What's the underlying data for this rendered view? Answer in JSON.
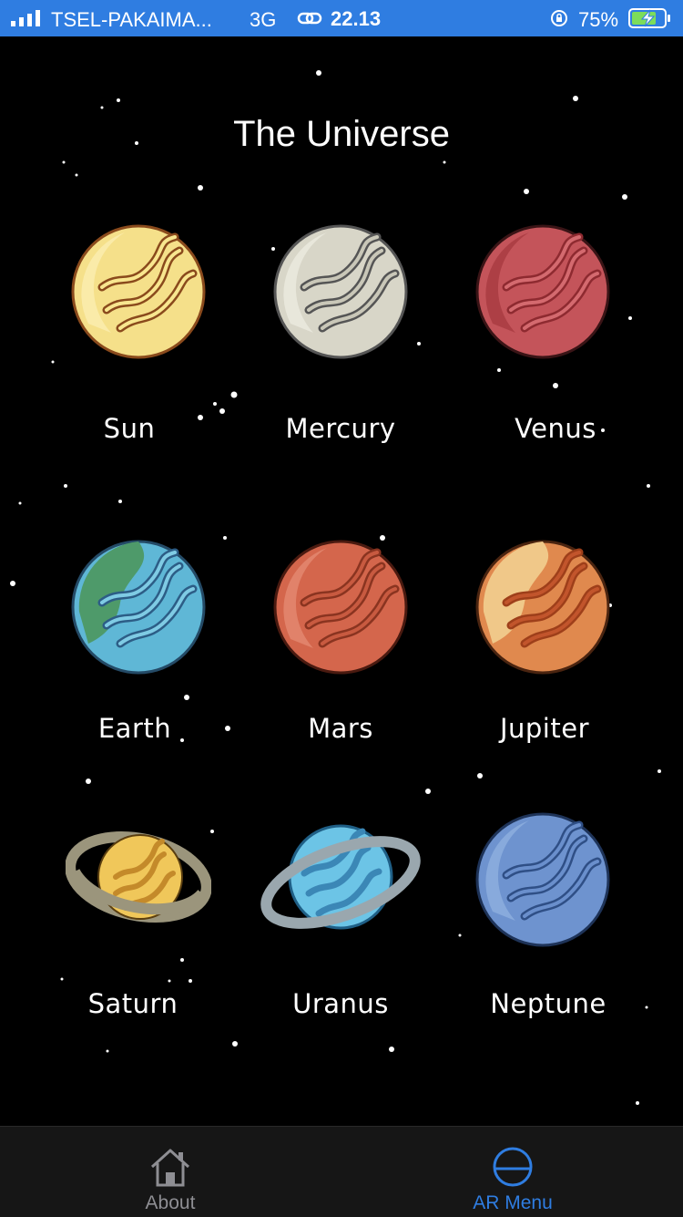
{
  "status_bar": {
    "carrier": "TSEL-PAKAIMA...",
    "network": "3G",
    "time": "22.13",
    "battery": "75%",
    "icons": [
      "signal-icon",
      "link-icon",
      "orientation-lock-icon",
      "battery-charging-icon"
    ],
    "background": "#2f7de1"
  },
  "screen": {
    "title": "The Universe",
    "background": "#000000"
  },
  "planets": [
    {
      "label": "Sun",
      "color": "#f5e08a"
    },
    {
      "label": "Mercury",
      "color": "#d8d6c8"
    },
    {
      "label": "Venus",
      "color": "#c4545a"
    },
    {
      "label": "Earth",
      "color": "#5fb7d6"
    },
    {
      "label": "Mars",
      "color": "#d4664c"
    },
    {
      "label": "Jupiter",
      "color": "#e0894e"
    },
    {
      "label": "Saturn",
      "color": "#f0c75a"
    },
    {
      "label": "Uranus",
      "color": "#6cc4e6"
    },
    {
      "label": "Neptune",
      "color": "#6e93cf"
    }
  ],
  "tab_bar": {
    "tabs": [
      {
        "label": "About",
        "icon": "home-icon",
        "selected": false
      },
      {
        "label": "AR Menu",
        "icon": "circle-icon",
        "selected": true
      }
    ],
    "accent": "#2f7de1",
    "inactive_color": "#8e8e93"
  }
}
